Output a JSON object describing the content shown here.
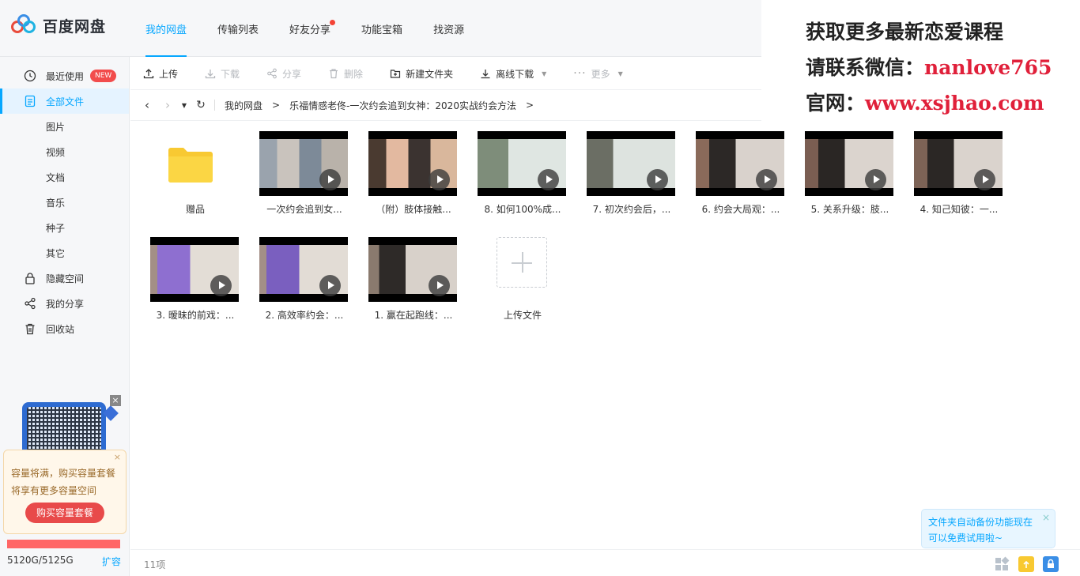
{
  "app": {
    "name": "百度网盘"
  },
  "nav": {
    "tabs": [
      {
        "label": "我的网盘"
      },
      {
        "label": "传输列表"
      },
      {
        "label": "好友分享"
      },
      {
        "label": "功能宝箱"
      },
      {
        "label": "找资源"
      }
    ]
  },
  "promo": {
    "line1": "获取更多最新恋爱课程",
    "line2_prefix": "请联系微信：",
    "line2_value": "nanlove765",
    "line3_prefix": "官网：",
    "line3_value": "www.xsjhao.com"
  },
  "sidebar": {
    "items": [
      {
        "label": "最近使用",
        "icon": "clock-icon",
        "badge": "NEW"
      },
      {
        "label": "全部文件",
        "icon": "file-icon"
      },
      {
        "label": "图片"
      },
      {
        "label": "视频"
      },
      {
        "label": "文档"
      },
      {
        "label": "音乐"
      },
      {
        "label": "种子"
      },
      {
        "label": "其它"
      },
      {
        "label": "隐藏空间",
        "icon": "lock-icon"
      },
      {
        "label": "我的分享",
        "icon": "share-icon"
      },
      {
        "label": "回收站",
        "icon": "trash-icon"
      }
    ],
    "capacity_tip": {
      "line1": "容量将满，购买容量套餐",
      "line2": "将享有更多容量空间",
      "buy_label": "购买容量套餐"
    },
    "capacity": {
      "used_text": "5120G/5125G",
      "used_fraction": 0.999,
      "expand_label": "扩容"
    }
  },
  "toolbar": {
    "upload": "上传",
    "download": "下载",
    "share": "分享",
    "delete": "删除",
    "new_folder": "新建文件夹",
    "offline_download": "离线下载",
    "more": "更多"
  },
  "breadcrumb": {
    "root": "我的网盘",
    "folder": "乐福情感老佟-一次约会追到女神：2020实战约会方法",
    "sep": ">"
  },
  "files": [
    {
      "name": "赠品",
      "type": "folder"
    },
    {
      "name": "一次约会追到女...",
      "type": "video"
    },
    {
      "name": "（附）肢体接触...",
      "type": "video"
    },
    {
      "name": "8. 如何100%成...",
      "type": "video"
    },
    {
      "name": "7. 初次约会后，...",
      "type": "video"
    },
    {
      "name": "6. 约会大局观：...",
      "type": "video"
    },
    {
      "name": "5. 关系升级：肢...",
      "type": "video"
    },
    {
      "name": "4. 知己知彼：一...",
      "type": "video"
    },
    {
      "name": "3. 暧昧的前戏：...",
      "type": "video"
    },
    {
      "name": "2. 高效率约会：...",
      "type": "video"
    },
    {
      "name": "1. 赢在起跑线：...",
      "type": "video"
    },
    {
      "name": "上传文件",
      "type": "upload"
    }
  ],
  "status": {
    "count": "11项"
  },
  "backup_tip": {
    "line1": "文件夹自动备份功能现在",
    "line2": "可以免费试用啦~"
  },
  "colors": {
    "accent": "#06a7ff",
    "danger": "#e84a4a",
    "promo_red": "#e0203a"
  }
}
